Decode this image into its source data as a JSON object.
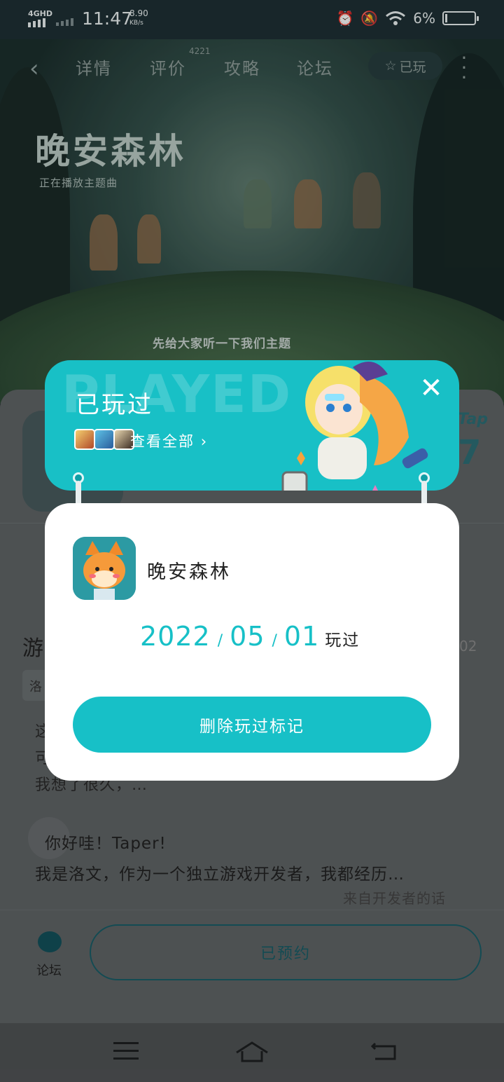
{
  "status_bar": {
    "network": "4GHD",
    "time": "11:47",
    "speed_value": "8.90",
    "speed_unit": "KB/s",
    "battery": "6%",
    "battery_level_fraction": 0.06,
    "icons": [
      "alarm-icon",
      "mute-icon",
      "wifi-icon",
      "battery-icon"
    ]
  },
  "nav": {
    "back_icon": "chevron-left-icon",
    "tabs": [
      {
        "label": "详情"
      },
      {
        "label": "评价",
        "badge": "4221"
      },
      {
        "label": "攻略"
      },
      {
        "label": "论坛"
      }
    ],
    "played_label": "已玩",
    "more_icon": "more-vertical-icon"
  },
  "hero": {
    "logo_text": "晚安森林",
    "subtitle": "正在播放主题曲",
    "caption": "先给大家听一下我们主题"
  },
  "background_page": {
    "tap_logo": "Tap",
    "score": "7",
    "section_title": "游",
    "chip_text": "洛",
    "right_number": "02",
    "desc_lines": [
      "这",
      "可",
      "我想了很久，…"
    ],
    "dev_greeting": "你好哇！Taper!",
    "dev_intro": "我是洛文，作为一个独立游戏开发者，我都经历…",
    "dev_source": "来自开发者的话"
  },
  "bottom_bar": {
    "forum_label": "论坛",
    "reserve_label": "已预约"
  },
  "dialog": {
    "watermark": "PLAYED",
    "title": "已玩过",
    "view_all": "查看全部",
    "game_name": "晚安森林",
    "date": {
      "year": "2022",
      "month": "05",
      "day": "01",
      "separator": "/",
      "suffix": "玩过"
    },
    "delete_button": "删除玩过标记",
    "colors": {
      "accent": "#17c0c7",
      "banner": "#18c0c6"
    }
  },
  "system_nav": {
    "menu_icon": "menu-icon",
    "home_icon": "home-icon",
    "back_icon": "back-icon"
  }
}
